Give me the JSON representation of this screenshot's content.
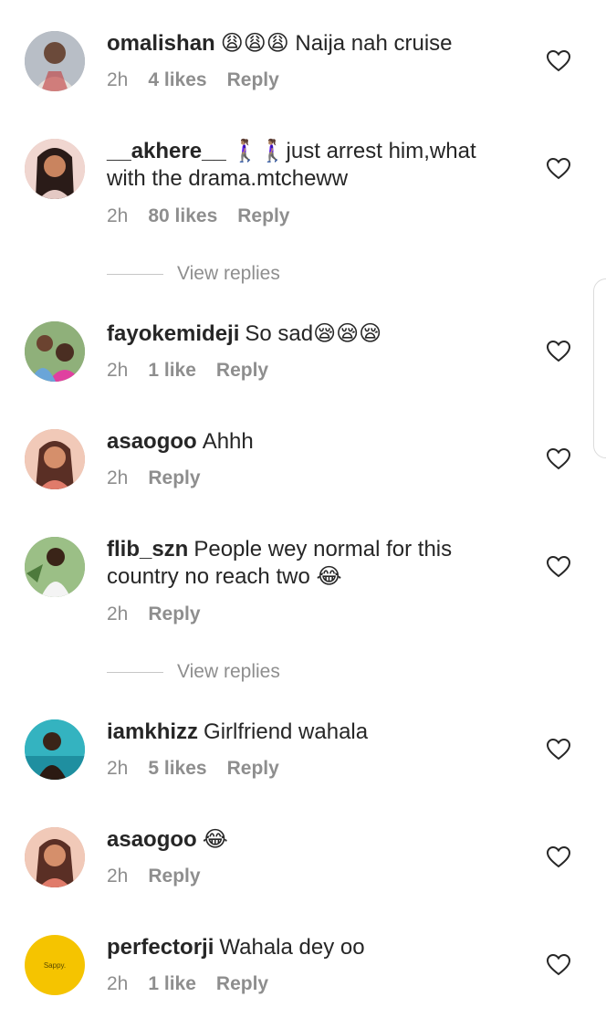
{
  "comments": [
    {
      "username": "omalishan",
      "text": "😩😩😩 Naija nah cruise",
      "time": "2h",
      "likes": "4 likes",
      "reply": "Reply",
      "avatar_color": "#8a8f98"
    },
    {
      "username": "__akhere__",
      "text": "🚶🏽‍♀️🚶🏽‍♀️just arrest him,what with the drama.mtcheww",
      "time": "2h",
      "likes": "80 likes",
      "reply": "Reply",
      "avatar_color": "#c9847a"
    },
    {
      "username": "fayokemideji",
      "text": "So sad😪😪😪",
      "time": "2h",
      "likes": "1 like",
      "reply": "Reply",
      "avatar_color": "#6f8a5c"
    },
    {
      "username": "asaogoo",
      "text": "Ahhh",
      "time": "2h",
      "likes": "",
      "reply": "Reply",
      "avatar_color": "#c98d7c"
    },
    {
      "username": "flib_szn",
      "text": "People wey normal for this country no reach two 😂",
      "time": "2h",
      "likes": "",
      "reply": "Reply",
      "avatar_color": "#7c9a6a"
    },
    {
      "username": "iamkhizz",
      "text": "Girlfriend wahala",
      "time": "2h",
      "likes": "5 likes",
      "reply": "Reply",
      "avatar_color": "#3fb2b8"
    },
    {
      "username": "asaogoo",
      "text": "😂",
      "time": "2h",
      "likes": "",
      "reply": "Reply",
      "avatar_color": "#c98d7c"
    },
    {
      "username": "perfectorji",
      "text": "Wahala dey oo",
      "time": "2h",
      "likes": "1 like",
      "reply": "Reply",
      "avatar_color": "#f5c400",
      "avatar_text": "Sappy."
    }
  ],
  "view_replies": [
    "View replies",
    "View replies"
  ],
  "icons": {
    "like": "heart-outline-icon"
  }
}
